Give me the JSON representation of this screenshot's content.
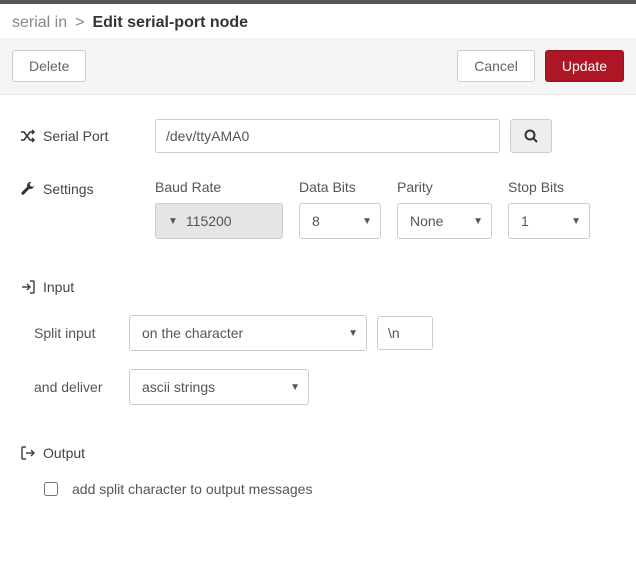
{
  "header": {
    "parent": "serial in",
    "separator": ">",
    "title": "Edit serial-port node"
  },
  "actions": {
    "delete": "Delete",
    "cancel": "Cancel",
    "update": "Update"
  },
  "form": {
    "serial_port": {
      "label": "Serial Port",
      "value": "/dev/ttyAMA0"
    },
    "settings": {
      "label": "Settings",
      "baud": {
        "label": "Baud Rate",
        "value": "115200"
      },
      "databits": {
        "label": "Data Bits",
        "value": "8"
      },
      "parity": {
        "label": "Parity",
        "value": "None"
      },
      "stopbits": {
        "label": "Stop Bits",
        "value": "1"
      }
    },
    "input": {
      "section_label": "Input",
      "split_label": "Split input",
      "split_mode": "on the character",
      "split_char": "\\n",
      "deliver_label": "and deliver",
      "deliver_mode": "ascii strings"
    },
    "output": {
      "section_label": "Output",
      "add_split_checked": false,
      "add_split_label": "add split character to output messages"
    }
  }
}
